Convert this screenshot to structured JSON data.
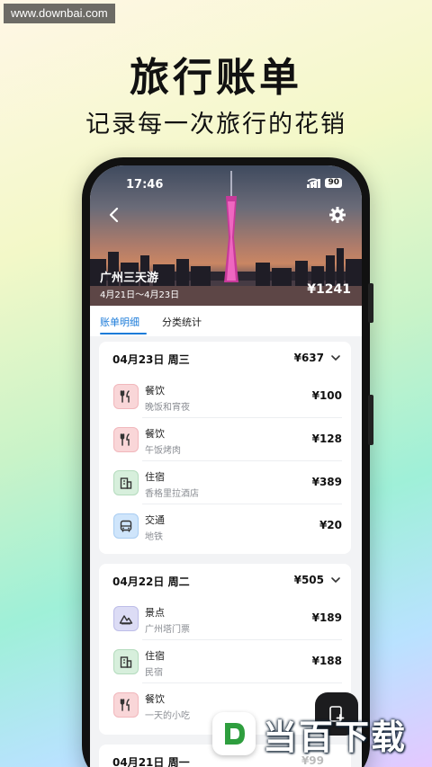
{
  "watermark": "www.downbai.com",
  "headline": {
    "title": "旅行账单",
    "subtitle": "记录每一次旅行的花销"
  },
  "status_bar": {
    "time": "17:46",
    "battery": "90"
  },
  "trip": {
    "name": "广州三天游",
    "dates": "4月21日～4月23日",
    "total": "¥1241"
  },
  "tabs": [
    {
      "label": "账单明细",
      "active": true
    },
    {
      "label": "分类统计",
      "active": false
    }
  ],
  "days": [
    {
      "date": "04月23日 周三",
      "total": "¥637",
      "items": [
        {
          "category": "餐饮",
          "note": "晚饭和宵夜",
          "amount": "¥100",
          "icon": "utensils-icon"
        },
        {
          "category": "餐饮",
          "note": "午饭烤肉",
          "amount": "¥128",
          "icon": "utensils-icon"
        },
        {
          "category": "住宿",
          "note": "香格里拉酒店",
          "amount": "¥389",
          "icon": "hotel-icon"
        },
        {
          "category": "交通",
          "note": "地铁",
          "amount": "¥20",
          "icon": "bus-icon"
        }
      ]
    },
    {
      "date": "04月22日 周二",
      "total": "¥505",
      "items": [
        {
          "category": "景点",
          "note": "广州塔门票",
          "amount": "¥189",
          "icon": "mountain-icon"
        },
        {
          "category": "住宿",
          "note": "民宿",
          "amount": "¥188",
          "icon": "hotel-icon"
        },
        {
          "category": "餐饮",
          "note": "一天的小吃",
          "amount": "",
          "icon": "utensils-icon"
        }
      ]
    },
    {
      "date": "04月21日 周一",
      "total": "¥99"
    }
  ],
  "logo": {
    "text": "当百下载"
  },
  "colors": {
    "accent": "#1b7bd9",
    "food": "#f9d6d8",
    "hotel": "#d7efdc",
    "transit": "#cfe5fb",
    "scenic": "#dcdcf5"
  }
}
